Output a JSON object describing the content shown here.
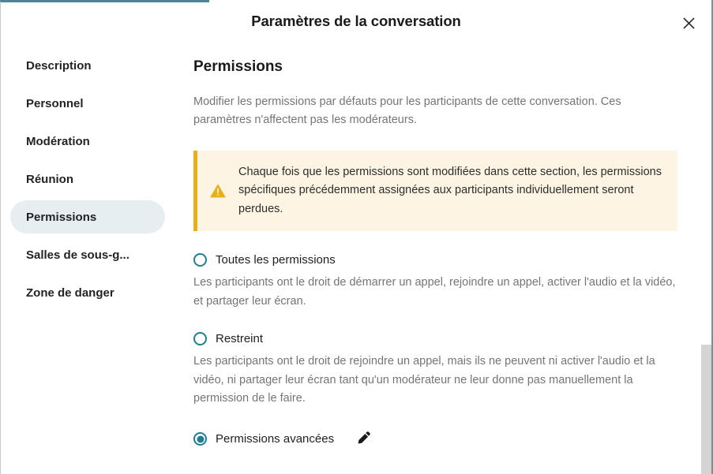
{
  "window": {
    "title": "Paramètres de la conversation",
    "close_label": "×",
    "accent_teal": "#1d7f91",
    "chrome_teal": "#4d8596"
  },
  "sidebar": {
    "items": [
      {
        "label": "Description",
        "active": false
      },
      {
        "label": "Personnel",
        "active": false
      },
      {
        "label": "Modération",
        "active": false
      },
      {
        "label": "Réunion",
        "active": false
      },
      {
        "label": "Permissions",
        "active": true
      },
      {
        "label": "Salles de sous-g...",
        "active": false
      },
      {
        "label": "Zone de danger",
        "active": false
      }
    ],
    "active_bg": "#e7eef1"
  },
  "main": {
    "title": "Permissions",
    "description": "Modifier les permissions par défauts pour les participants de cette conversation. Ces paramètres n'affectent pas les modérateurs.",
    "callout": {
      "icon": "warning-triangle-icon",
      "text": "Chaque fois que les permissions sont modifiées dans cette section, les permissions spécifiques précédemment assignées aux participants individuellement seront perdues.",
      "bg": "#fdf4e3",
      "border": "#e8b018"
    },
    "options": [
      {
        "label": "Toutes les permissions",
        "selected": false,
        "description": "Les participants ont le droit de démarrer un appel, rejoindre un appel, activer l'audio et la vidéo, et partager leur écran."
      },
      {
        "label": "Restreint",
        "selected": false,
        "description": "Les participants ont le droit de rejoindre un appel, mais ils ne peuvent ni activer l'audio et la vidéo, ni partager leur écran tant qu'un modérateur ne leur donne pas manuellement la permission de le faire."
      },
      {
        "label": "Permissions avancées",
        "selected": true,
        "description": "",
        "edit_icon": "pencil-icon"
      }
    ]
  },
  "scrollbar": {
    "thumb_color": "#d4d4d4"
  }
}
